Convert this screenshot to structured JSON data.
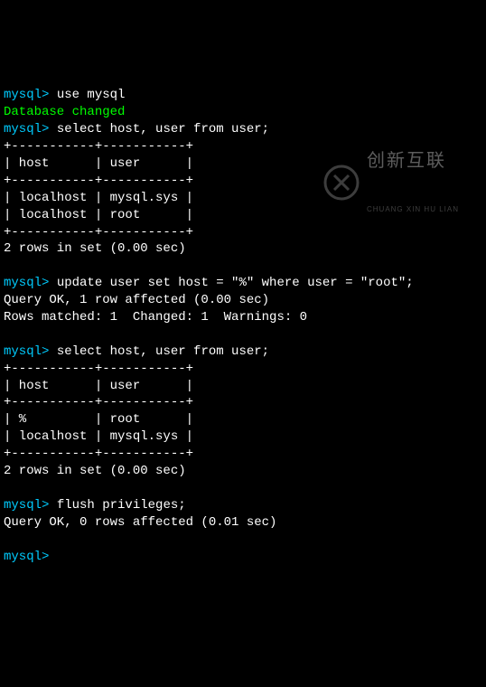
{
  "prompt": "mysql>",
  "cmd1": " use mysql",
  "response1": "Database changed",
  "cmd2": " select host, user from user;",
  "table1": {
    "border_top": "+-----------+-----------+",
    "header": "| host      | user      |",
    "border_mid": "+-----------+-----------+",
    "row1": "| localhost | mysql.sys |",
    "row2": "| localhost | root      |",
    "border_bot": "+-----------+-----------+"
  },
  "result1": "2 rows in set (0.00 sec)",
  "cmd3": " update user set host = \"%\" where user = \"root\";",
  "response3a": "Query OK, 1 row affected (0.00 sec)",
  "response3b": "Rows matched: 1  Changed: 1  Warnings: 0",
  "cmd4": " select host, user from user;",
  "table2": {
    "border_top": "+-----------+-----------+",
    "header": "| host      | user      |",
    "border_mid": "+-----------+-----------+",
    "row1": "| %         | root      |",
    "row2": "| localhost | mysql.sys |",
    "border_bot": "+-----------+-----------+"
  },
  "result2": "2 rows in set (0.00 sec)",
  "cmd5": " flush privileges;",
  "response5": "Query OK, 0 rows affected (0.01 sec)",
  "watermark": {
    "cn": "创新互联",
    "en": "CHUANG XIN HU LIAN"
  }
}
